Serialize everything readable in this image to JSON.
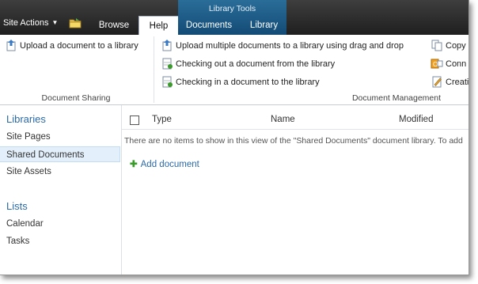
{
  "topbar": {
    "site_actions": "Site Actions",
    "tabs": {
      "browse": "Browse",
      "help": "Help",
      "documents": "Documents",
      "library": "Library"
    },
    "library_tools": "Library Tools"
  },
  "ribbon": {
    "document_sharing": {
      "label": "Document Sharing",
      "items": [
        "Upload a document to a library"
      ]
    },
    "document_management": {
      "label": "Document Management",
      "items": [
        "Upload multiple documents to a library using drag and drop",
        "Checking out a document from the library",
        "Checking in a document to the library",
        "Copy",
        "Conn",
        "Creati"
      ]
    }
  },
  "leftnav": {
    "libraries_heading": "Libraries",
    "libraries": [
      "Site Pages",
      "Shared Documents",
      "Site Assets"
    ],
    "lists_heading": "Lists",
    "lists": [
      "Calendar",
      "Tasks"
    ],
    "selected": "Shared Documents"
  },
  "main": {
    "columns": [
      "Type",
      "Name",
      "Modified"
    ],
    "empty_message": "There are no items to show in this view of the \"Shared Documents\" document library. To add",
    "add_document": "Add document"
  },
  "icons": {
    "site_actions": "folder-icon",
    "upload": "upload-icon",
    "checkout": "checkout-icon",
    "checkin": "checkin-icon"
  },
  "colors": {
    "accent": "#2b6aa8",
    "topbar": "#2a2a2a",
    "library_tools": "#1d5a86",
    "selected_nav": "#e3f0fb"
  }
}
